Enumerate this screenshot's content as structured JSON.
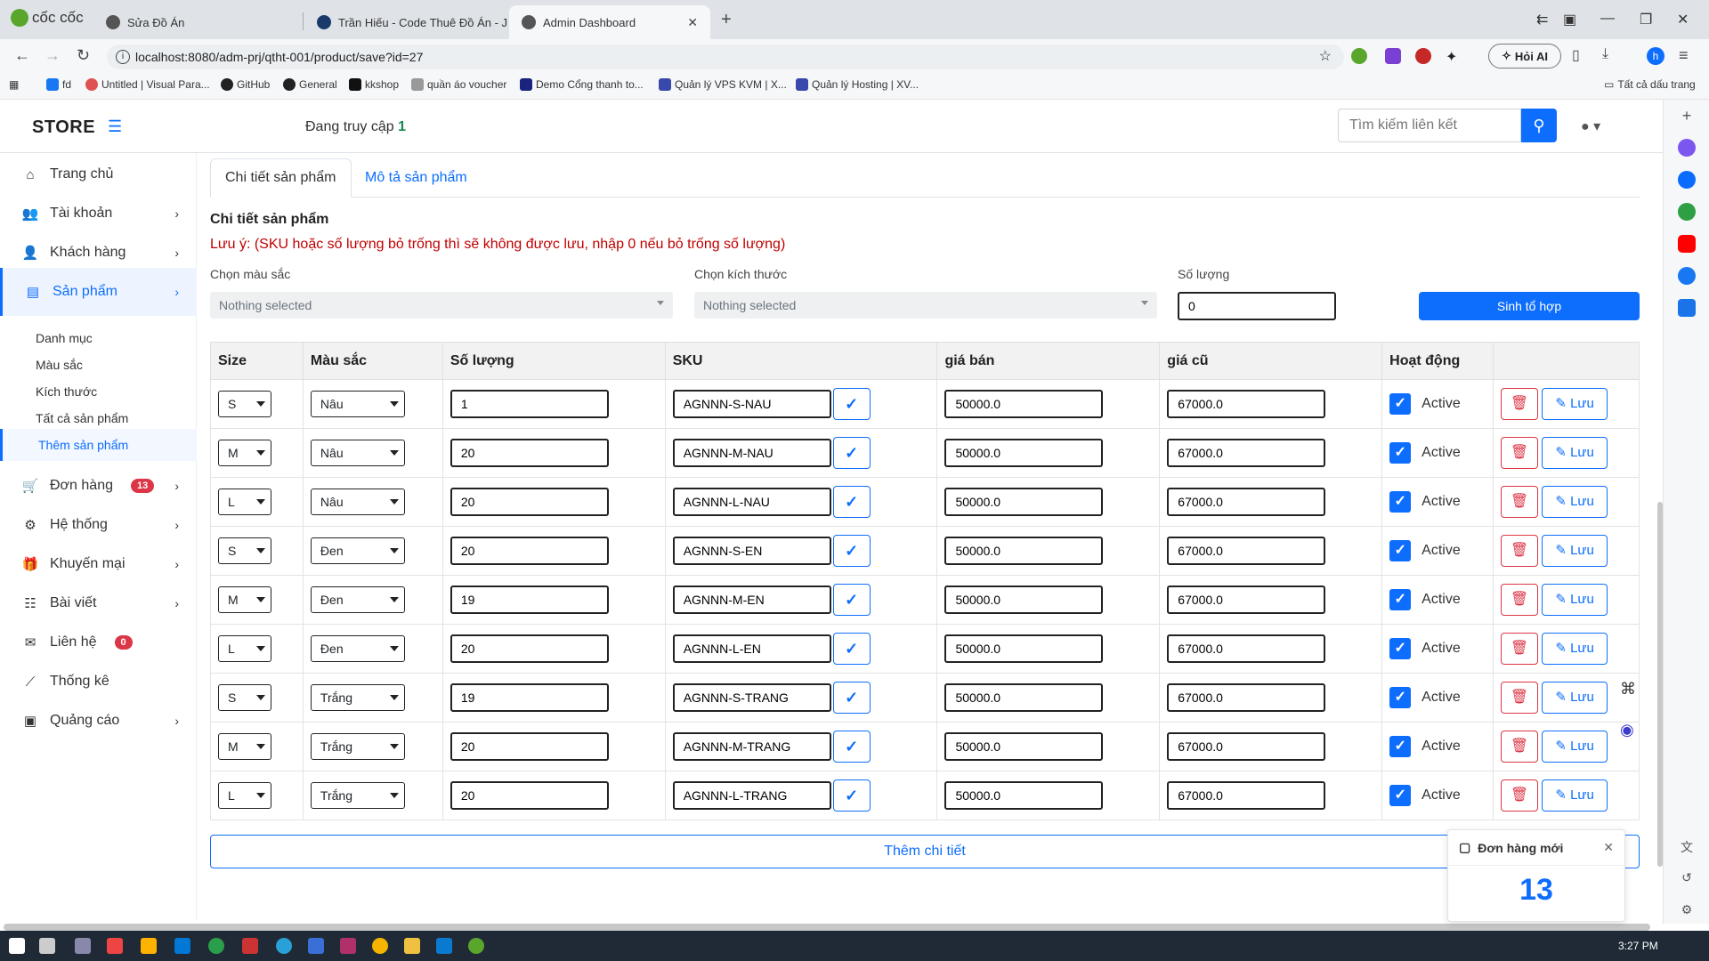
{
  "browser": {
    "name": "cốc cốc",
    "tabs": [
      {
        "title": "Sửa Đồ Án"
      },
      {
        "title": "Trần Hiếu - Code Thuê Đồ Án - J"
      },
      {
        "title": "Admin Dashboard"
      }
    ],
    "url": "localhost:8080/adm-prj/qtht-001/product/save?id=27",
    "hoi_ai": "Hỏi AI",
    "profile_initial": "h",
    "bookmarks": [
      "fd",
      "Untitled | Visual Para...",
      "GitHub",
      "General",
      "kkshop",
      "quần áo voucher",
      "Demo Cổng thanh to...",
      "Quản lý VPS KVM | X...",
      "Quản lý Hosting | XV..."
    ],
    "all_bookmarks": "Tất cả dấu trang"
  },
  "header": {
    "brand": "STORE",
    "online_label": "Đang truy cập",
    "online_count": "1",
    "search_placeholder": "Tìm kiếm liên kết"
  },
  "sidebar": {
    "items": [
      {
        "label": "Trang chủ",
        "icon": "home-icon"
      },
      {
        "label": "Tài khoản",
        "icon": "users-icon"
      },
      {
        "label": "Khách hàng",
        "icon": "user-group-icon"
      },
      {
        "label": "Sản phẩm",
        "icon": "cubes-icon"
      },
      {
        "label": "Đơn hàng",
        "icon": "cart-icon",
        "badge": "13"
      },
      {
        "label": "Hệ thống",
        "icon": "gears-icon"
      },
      {
        "label": "Khuyến mại",
        "icon": "gift-icon"
      },
      {
        "label": "Bài viết",
        "icon": "list-icon"
      },
      {
        "label": "Liên hệ",
        "icon": "envelope-icon",
        "badge": "0"
      },
      {
        "label": "Thống kê",
        "icon": "chart-line-icon"
      },
      {
        "label": "Quảng cáo",
        "icon": "ad-icon"
      }
    ],
    "product_sub": [
      "Danh mục",
      "Màu sắc",
      "Kích thước",
      "Tất cả sản phẩm",
      "Thêm sản phẩm"
    ]
  },
  "main": {
    "tabs": [
      "Chi tiết sản phẩm",
      "Mô tả sản phẩm"
    ],
    "section_title": "Chi tiết sản phẩm",
    "note": "Lưu ý: (SKU hoặc số lượng bỏ trống thì sẽ không được lưu, nhập 0 nếu bỏ trống số lượng)",
    "color_label": "Chọn màu sắc",
    "size_label": "Chọn kích thước",
    "qty_label": "Số lượng",
    "nothing_selected": "Nothing selected",
    "qty_value": "0",
    "generate_button": "Sinh tổ hợp",
    "columns": [
      "Size",
      "Màu sắc",
      "Số lượng",
      "SKU",
      "giá bán",
      "giá cũ",
      "Hoạt động"
    ],
    "active_label": "Active",
    "save_label": "Lưu",
    "rows": [
      {
        "size": "S",
        "color": "Nâu",
        "qty": "1",
        "sku": "AGNNN-S-NAU",
        "price": "50000.0",
        "old_price": "67000.0"
      },
      {
        "size": "M",
        "color": "Nâu",
        "qty": "20",
        "sku": "AGNNN-M-NAU",
        "price": "50000.0",
        "old_price": "67000.0"
      },
      {
        "size": "L",
        "color": "Nâu",
        "qty": "20",
        "sku": "AGNNN-L-NAU",
        "price": "50000.0",
        "old_price": "67000.0"
      },
      {
        "size": "S",
        "color": "Đen",
        "qty": "20",
        "sku": "AGNNN-S-EN",
        "price": "50000.0",
        "old_price": "67000.0"
      },
      {
        "size": "M",
        "color": "Đen",
        "qty": "19",
        "sku": "AGNNN-M-EN",
        "price": "50000.0",
        "old_price": "67000.0"
      },
      {
        "size": "L",
        "color": "Đen",
        "qty": "20",
        "sku": "AGNNN-L-EN",
        "price": "50000.0",
        "old_price": "67000.0"
      },
      {
        "size": "S",
        "color": "Trắng",
        "qty": "19",
        "sku": "AGNNN-S-TRANG",
        "price": "50000.0",
        "old_price": "67000.0"
      },
      {
        "size": "M",
        "color": "Trắng",
        "qty": "20",
        "sku": "AGNNN-M-TRANG",
        "price": "50000.0",
        "old_price": "67000.0"
      },
      {
        "size": "L",
        "color": "Trắng",
        "qty": "20",
        "sku": "AGNNN-L-TRANG",
        "price": "50000.0",
        "old_price": "67000.0"
      }
    ],
    "add_detail": "Thêm chi tiết"
  },
  "toast": {
    "title": "Đơn hàng mới",
    "count": "13"
  },
  "taskbar": {
    "time": "3:27 PM"
  },
  "colors": {
    "primary": "#0d6efd",
    "danger": "#dc3545",
    "success": "#198754"
  }
}
